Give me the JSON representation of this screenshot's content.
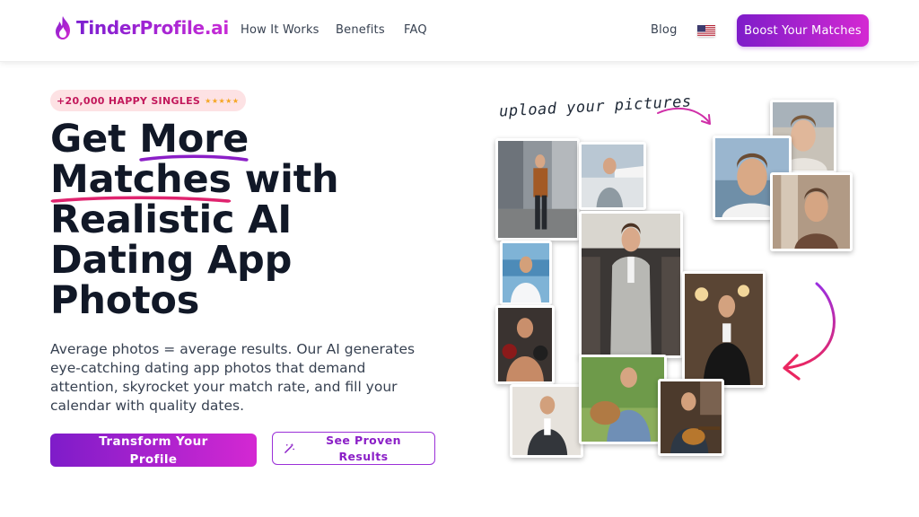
{
  "header": {
    "logo_text": "TinderProfile.ai",
    "nav": {
      "how_it_works": "How It Works",
      "benefits": "Benefits",
      "faq": "FAQ",
      "blog": "Blog"
    },
    "language_flag": "us-flag-icon",
    "boost_button": "Boost Your Matches"
  },
  "hero": {
    "badge": "+20,000 HAPPY SINGLES",
    "badge_stars": "★★★★★",
    "headline": {
      "part1": "Get ",
      "part2": "More",
      "part3": "Matches",
      "part4": " with Realistic AI Dating App Photos"
    },
    "description": "Average photos = average results. Our AI generates eye-catching dating app photos that demand attention, skyrocket your match rate, and fill your calendar with quality dates.",
    "primary_cta": "Transform Your Profile",
    "secondary_cta": "See Proven Results",
    "upload_hint": "upload your pictures"
  },
  "colors": {
    "brand_start": "#7e1cc9",
    "brand_end": "#d428d2",
    "badge_bg": "#fde2e4",
    "badge_text": "#c2185b",
    "arrow": "#e0246f"
  }
}
